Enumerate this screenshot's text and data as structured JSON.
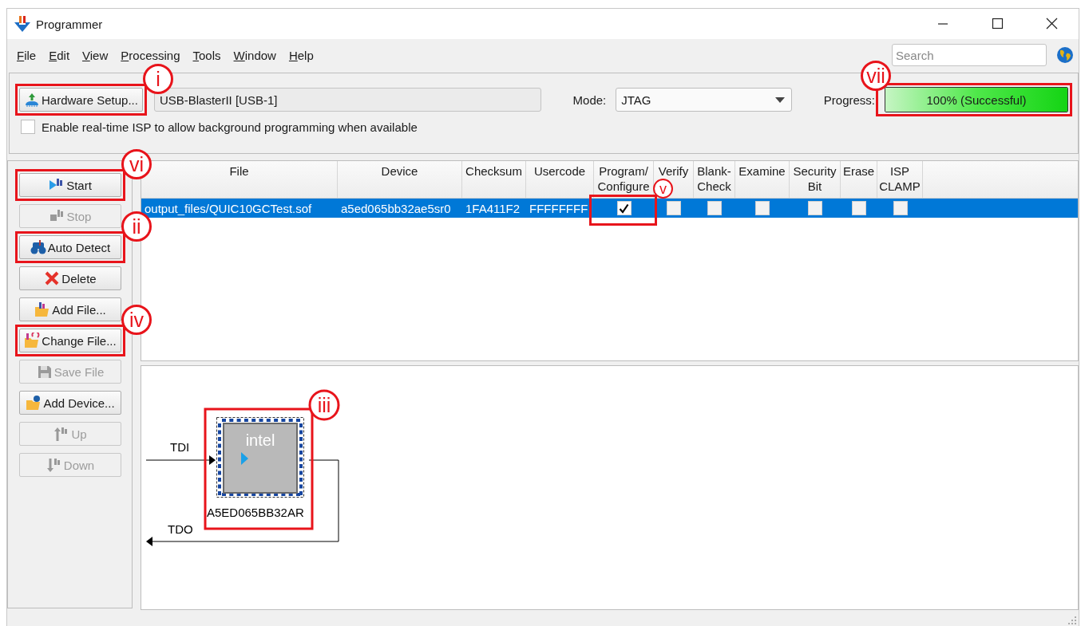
{
  "window": {
    "title": "Programmer"
  },
  "menu": [
    {
      "label": "File"
    },
    {
      "label": "Edit"
    },
    {
      "label": "View"
    },
    {
      "label": "Processing"
    },
    {
      "label": "Tools"
    },
    {
      "label": "Window"
    },
    {
      "label": "Help"
    }
  ],
  "search": {
    "placeholder": "Search"
  },
  "toolbar": {
    "hardware_button": {
      "label": "Hardware Setup...",
      "callout": "i"
    },
    "hardware": "USB-BlasterII [USB-1]",
    "mode_label": "Mode:",
    "mode": "JTAG",
    "progress_label": "Progress:",
    "progress": {
      "level": 1,
      "text": "100% (Successful)",
      "callout": "vii"
    },
    "realtime_isp": {
      "label": "Enable real-time ISP to allow background programming when available",
      "checked": false
    }
  },
  "side_buttons": [
    {
      "label": "Start",
      "disabled": false,
      "callout": "vi"
    },
    {
      "label": "Stop",
      "disabled": true
    },
    {
      "label": "Auto Detect",
      "disabled": false,
      "callout": "ii"
    },
    {
      "label": "Delete",
      "disabled": false
    },
    {
      "label": "Add File...",
      "disabled": false
    },
    {
      "label": "Change File...",
      "disabled": false,
      "callout": "iv"
    },
    {
      "label": "Save File",
      "disabled": true
    },
    {
      "label": "Add Device...",
      "disabled": false
    },
    {
      "label": "Up",
      "disabled": true
    },
    {
      "label": "Down",
      "disabled": true
    }
  ],
  "table": {
    "columns": [
      {
        "lines": [
          "File"
        ]
      },
      {
        "lines": [
          "Device"
        ]
      },
      {
        "lines": [
          "Checksum"
        ]
      },
      {
        "lines": [
          "Usercode"
        ]
      },
      {
        "lines": [
          "Program/",
          "Configure"
        ]
      },
      {
        "lines": [
          "Verify"
        ]
      },
      {
        "lines": [
          "Blank-",
          "Check"
        ]
      },
      {
        "lines": [
          "Examine"
        ]
      },
      {
        "lines": [
          "Security",
          "Bit"
        ]
      },
      {
        "lines": [
          "Erase"
        ]
      },
      {
        "lines": [
          "ISP",
          "CLAMP"
        ]
      }
    ],
    "rows": [
      {
        "selected": true,
        "cells": [
          "output_files/QUIC10GCTest.sof",
          "a5ed065bb32ae5sr0",
          "1FA411F2",
          "FFFFFFFF"
        ],
        "checks": [
          {
            "checked": true,
            "callout": "v"
          },
          {
            "checked": false
          },
          {
            "checked": false
          },
          {
            "checked": false
          },
          {
            "checked": false
          },
          {
            "checked": false
          },
          {
            "checked": false
          }
        ]
      }
    ]
  },
  "chain": {
    "tdi": "TDI",
    "tdo": "TDO",
    "device": {
      "logo": "intel",
      "label": "A5ED065BB32AR",
      "callout": "iii"
    }
  }
}
